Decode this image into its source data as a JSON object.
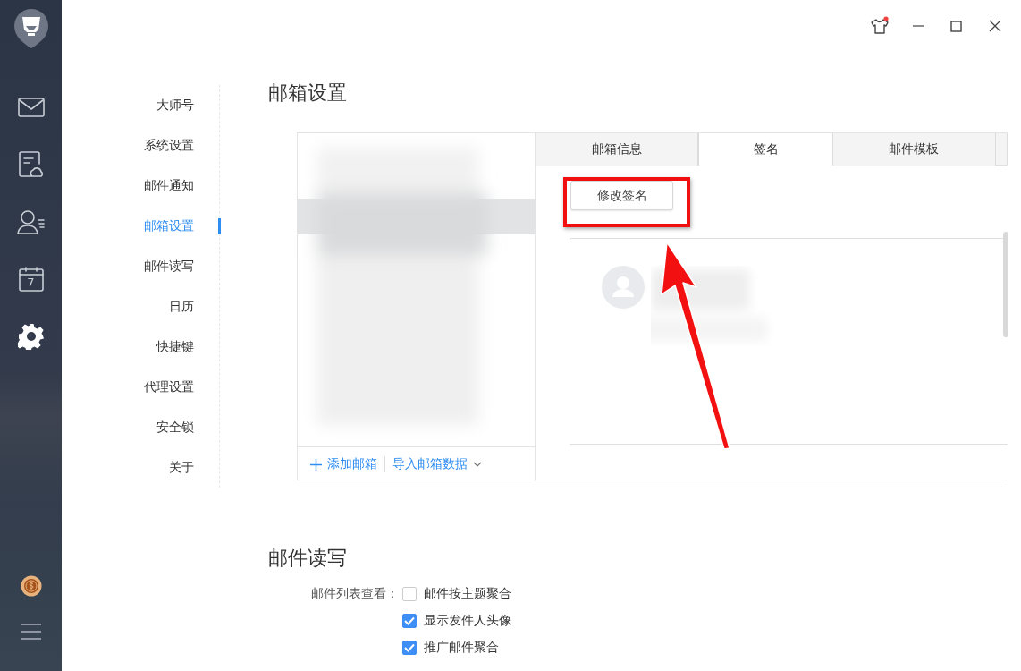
{
  "window_controls": [
    {
      "kind": "skin",
      "badge": true
    },
    {
      "kind": "minimize"
    },
    {
      "kind": "maximize"
    },
    {
      "kind": "close"
    }
  ],
  "rail": {
    "items": [
      {
        "kind": "mail",
        "selected": false
      },
      {
        "kind": "notes",
        "selected": false
      },
      {
        "kind": "contacts",
        "selected": false
      },
      {
        "kind": "calendar",
        "label": "7",
        "selected": false
      },
      {
        "kind": "settings",
        "selected": true
      }
    ],
    "bottom": [
      {
        "kind": "coin"
      },
      {
        "kind": "menu"
      }
    ]
  },
  "settings_nav": [
    {
      "label": "大师号",
      "selected": false
    },
    {
      "label": "系统设置",
      "selected": false
    },
    {
      "label": "邮件通知",
      "selected": false
    },
    {
      "label": "邮箱设置",
      "selected": true
    },
    {
      "label": "邮件读写",
      "selected": false
    },
    {
      "label": "日历",
      "selected": false
    },
    {
      "label": "快捷键",
      "selected": false
    },
    {
      "label": "代理设置",
      "selected": false
    },
    {
      "label": "安全锁",
      "selected": false
    },
    {
      "label": "关于",
      "selected": false
    }
  ],
  "mailbox_settings": {
    "title": "邮箱设置",
    "tabs": [
      {
        "label": "邮箱信息",
        "selected": false
      },
      {
        "label": "签名",
        "selected": true
      },
      {
        "label": "邮件模板",
        "selected": false
      }
    ],
    "edit_signature_button": {
      "label": "修改签名",
      "highlighted": true
    },
    "add_mailbox": "添加邮箱",
    "import_data": "导入邮箱数据"
  },
  "mail_read_write": {
    "title": "邮件读写",
    "list_view_label": "邮件列表查看：",
    "options": [
      {
        "label": "邮件按主题聚合",
        "checked": false
      },
      {
        "label": "显示发件人头像",
        "checked": true
      },
      {
        "label": "推广邮件聚合",
        "checked": true
      }
    ]
  }
}
